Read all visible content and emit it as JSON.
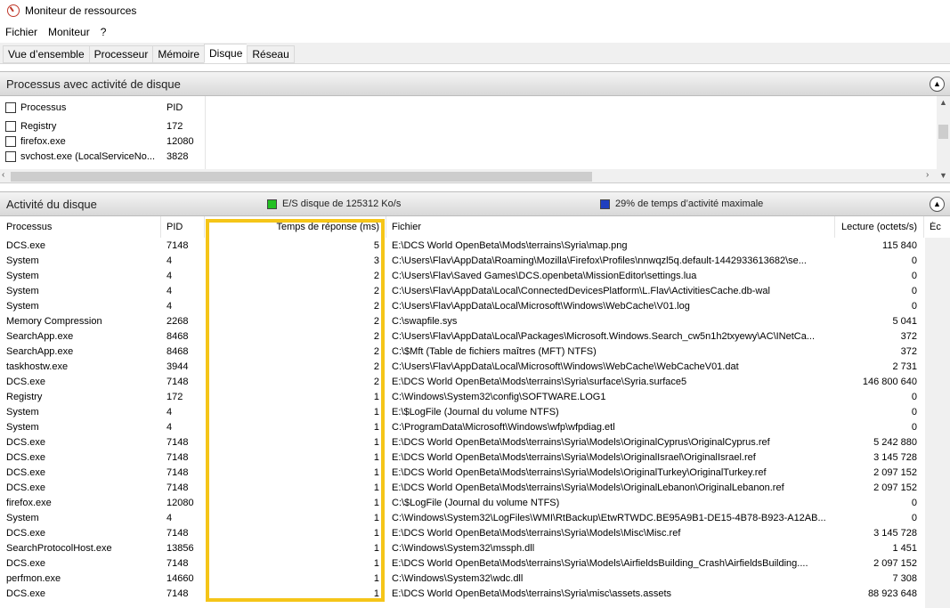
{
  "window": {
    "title": "Moniteur de ressources"
  },
  "menu": [
    "Fichier",
    "Moniteur",
    "?"
  ],
  "tabs": [
    "Vue d’ensemble",
    "Processeur",
    "Mémoire",
    "Disque",
    "Réseau"
  ],
  "active_tab": "Disque",
  "processes_section": {
    "title": "Processus avec activité de disque",
    "headers": {
      "process": "Processus",
      "pid": "PID"
    },
    "rows": [
      {
        "name": "Registry",
        "pid": "172"
      },
      {
        "name": "firefox.exe",
        "pid": "12080"
      },
      {
        "name": "svchost.exe (LocalServiceNo...",
        "pid": "3828"
      }
    ]
  },
  "disk_section": {
    "title": "Activité du disque",
    "io_label": "E/S disque de 125312 Ko/s",
    "active_label": "29% de temps d’activité maximale",
    "colors": {
      "io": "#22c022",
      "active": "#1f3fbf",
      "highlight": "#f5c518"
    },
    "headers": {
      "process": "Processus",
      "pid": "PID",
      "response": "Temps de réponse (ms)",
      "file": "Fichier",
      "read": "Lecture (octets/s)",
      "write": "Éc"
    },
    "rows": [
      {
        "process": "DCS.exe",
        "pid": "7148",
        "response": "5",
        "file": "E:\\DCS World OpenBeta\\Mods\\terrains\\Syria\\map.png",
        "read": "115 840"
      },
      {
        "process": "System",
        "pid": "4",
        "response": "3",
        "file": "C:\\Users\\Flav\\AppData\\Roaming\\Mozilla\\Firefox\\Profiles\\nnwqzl5q.default-1442933613682\\se...",
        "read": "0"
      },
      {
        "process": "System",
        "pid": "4",
        "response": "2",
        "file": "C:\\Users\\Flav\\Saved Games\\DCS.openbeta\\MissionEditor\\settings.lua",
        "read": "0"
      },
      {
        "process": "System",
        "pid": "4",
        "response": "2",
        "file": "C:\\Users\\Flav\\AppData\\Local\\ConnectedDevicesPlatform\\L.Flav\\ActivitiesCache.db-wal",
        "read": "0"
      },
      {
        "process": "System",
        "pid": "4",
        "response": "2",
        "file": "C:\\Users\\Flav\\AppData\\Local\\Microsoft\\Windows\\WebCache\\V01.log",
        "read": "0"
      },
      {
        "process": "Memory Compression",
        "pid": "2268",
        "response": "2",
        "file": "C:\\swapfile.sys",
        "read": "5 041"
      },
      {
        "process": "SearchApp.exe",
        "pid": "8468",
        "response": "2",
        "file": "C:\\Users\\Flav\\AppData\\Local\\Packages\\Microsoft.Windows.Search_cw5n1h2txyewy\\AC\\INetCa...",
        "read": "372"
      },
      {
        "process": "SearchApp.exe",
        "pid": "8468",
        "response": "2",
        "file": "C:\\$Mft (Table de fichiers maîtres (MFT) NTFS)",
        "read": "372"
      },
      {
        "process": "taskhostw.exe",
        "pid": "3944",
        "response": "2",
        "file": "C:\\Users\\Flav\\AppData\\Local\\Microsoft\\Windows\\WebCache\\WebCacheV01.dat",
        "read": "2 731"
      },
      {
        "process": "DCS.exe",
        "pid": "7148",
        "response": "2",
        "file": "E:\\DCS World OpenBeta\\Mods\\terrains\\Syria\\surface\\Syria.surface5",
        "read": "146 800 640"
      },
      {
        "process": "Registry",
        "pid": "172",
        "response": "1",
        "file": "C:\\Windows\\System32\\config\\SOFTWARE.LOG1",
        "read": "0"
      },
      {
        "process": "System",
        "pid": "4",
        "response": "1",
        "file": "E:\\$LogFile (Journal du volume NTFS)",
        "read": "0"
      },
      {
        "process": "System",
        "pid": "4",
        "response": "1",
        "file": "C:\\ProgramData\\Microsoft\\Windows\\wfp\\wfpdiag.etl",
        "read": "0"
      },
      {
        "process": "DCS.exe",
        "pid": "7148",
        "response": "1",
        "file": "E:\\DCS World OpenBeta\\Mods\\terrains\\Syria\\Models\\OriginalCyprus\\OriginalCyprus.ref",
        "read": "5 242 880"
      },
      {
        "process": "DCS.exe",
        "pid": "7148",
        "response": "1",
        "file": "E:\\DCS World OpenBeta\\Mods\\terrains\\Syria\\Models\\OriginalIsrael\\OriginalIsrael.ref",
        "read": "3 145 728"
      },
      {
        "process": "DCS.exe",
        "pid": "7148",
        "response": "1",
        "file": "E:\\DCS World OpenBeta\\Mods\\terrains\\Syria\\Models\\OriginalTurkey\\OriginalTurkey.ref",
        "read": "2 097 152"
      },
      {
        "process": "DCS.exe",
        "pid": "7148",
        "response": "1",
        "file": "E:\\DCS World OpenBeta\\Mods\\terrains\\Syria\\Models\\OriginalLebanon\\OriginalLebanon.ref",
        "read": "2 097 152"
      },
      {
        "process": "firefox.exe",
        "pid": "12080",
        "response": "1",
        "file": "C:\\$LogFile (Journal du volume NTFS)",
        "read": "0"
      },
      {
        "process": "System",
        "pid": "4",
        "response": "1",
        "file": "C:\\Windows\\System32\\LogFiles\\WMI\\RtBackup\\EtwRTWDC.BE95A9B1-DE15-4B78-B923-A12AB...",
        "read": "0"
      },
      {
        "process": "DCS.exe",
        "pid": "7148",
        "response": "1",
        "file": "E:\\DCS World OpenBeta\\Mods\\terrains\\Syria\\Models\\Misc\\Misc.ref",
        "read": "3 145 728"
      },
      {
        "process": "SearchProtocolHost.exe",
        "pid": "13856",
        "response": "1",
        "file": "C:\\Windows\\System32\\mssph.dll",
        "read": "1 451"
      },
      {
        "process": "DCS.exe",
        "pid": "7148",
        "response": "1",
        "file": "E:\\DCS World OpenBeta\\Mods\\terrains\\Syria\\Models\\AirfieldsBuilding_Crash\\AirfieldsBuilding....",
        "read": "2 097 152"
      },
      {
        "process": "perfmon.exe",
        "pid": "14660",
        "response": "1",
        "file": "C:\\Windows\\System32\\wdc.dll",
        "read": "7 308"
      },
      {
        "process": "DCS.exe",
        "pid": "7148",
        "response": "1",
        "file": "E:\\DCS World OpenBeta\\Mods\\terrains\\Syria\\misc\\assets.assets",
        "read": "88 923 648"
      }
    ]
  }
}
